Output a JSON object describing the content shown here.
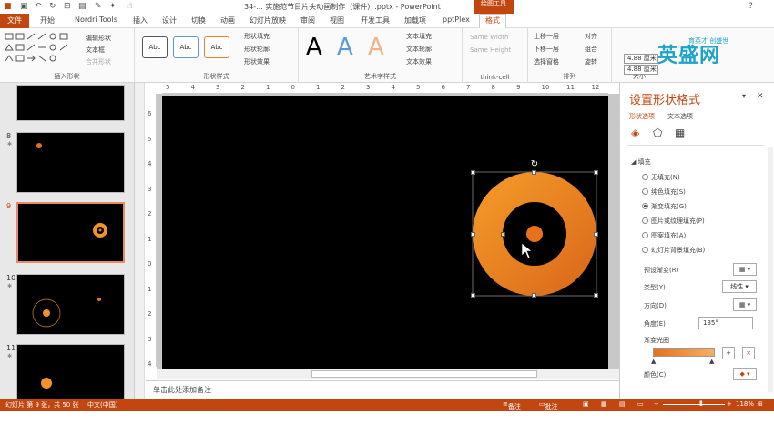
{
  "titlebar": {
    "title": "34-... 实施范节目片头动画制作（课件）.pptx - PowerPoint",
    "tools_group": "绘图工具"
  },
  "tabs": [
    "文件",
    "开始",
    "Nordri Tools",
    "插入",
    "设计",
    "切换",
    "动画",
    "幻灯片放映",
    "审阅",
    "视图",
    "开发工具",
    "加载项",
    "pptPlex",
    "格式"
  ],
  "ribbon": {
    "insert_shapes": {
      "label": "插入形状",
      "edit_shape": "编辑形状",
      "textbox": "文本框",
      "merge": "合并形状"
    },
    "shape_styles": {
      "label": "形状样式",
      "sample": "Abc",
      "fill": "形状填充",
      "outline": "形状轮廓",
      "effects": "形状效果"
    },
    "wordart": {
      "label": "艺术字样式",
      "letter": "A",
      "text_fill": "文本填充",
      "text_outline": "文本轮廓",
      "text_effects": "文本效果"
    },
    "thinkcell": {
      "label": "think-cell",
      "same_width": "Same Width",
      "same_height": "Same Height"
    },
    "arrange": {
      "label": "排列",
      "forward": "上移一层",
      "backward": "下移一层",
      "selection_pane": "选择窗格",
      "align": "对齐",
      "group": "组合",
      "rotate": "旋转"
    },
    "size": {
      "label": "大小",
      "height": "4.88 厘米",
      "width": "4.88 厘米"
    }
  },
  "logo": {
    "main": "英盛网",
    "sub": "育英才 创盛世"
  },
  "slides": [
    {
      "num": "8"
    },
    {
      "num": "9"
    },
    {
      "num": "10"
    },
    {
      "num": "11"
    }
  ],
  "hruler_ticks": [
    "5",
    "4",
    "3",
    "2",
    "1",
    "0",
    "1",
    "2",
    "3",
    "4",
    "5",
    "6",
    "7",
    "8",
    "9",
    "10",
    "11",
    "12"
  ],
  "vruler_ticks": [
    "6",
    "5",
    "4",
    "3",
    "2",
    "1",
    "0",
    "1",
    "2",
    "3",
    "4"
  ],
  "notes_placeholder": "单击此处添加备注",
  "pane": {
    "title": "设置形状格式",
    "tab_shape": "形状选项",
    "tab_text": "文本选项",
    "section_fill": "填充",
    "fill_options": [
      "无填充(N)",
      "纯色填充(S)",
      "渐变填充(G)",
      "图片或纹理填充(P)",
      "图案填充(A)",
      "幻灯片背景填充(B)"
    ],
    "selected_fill": 2,
    "preset_gradient": "预设渐变(R)",
    "type_label": "类型(Y)",
    "type_value": "线性",
    "direction_label": "方向(D)",
    "angle_label": "角度(E)",
    "angle_value": "135°",
    "stops_label": "渐变光圈",
    "color_label": "颜色(C)"
  },
  "status": {
    "slide_info": "幻灯片 第 9 张，共 50 张",
    "language": "中文(中国)",
    "notes": "备注",
    "comments": "批注",
    "zoom": "118%"
  },
  "colors": {
    "accent": "#c1460f",
    "ring_outer": "#f39a2b",
    "ring_inner": "#d9661a"
  }
}
